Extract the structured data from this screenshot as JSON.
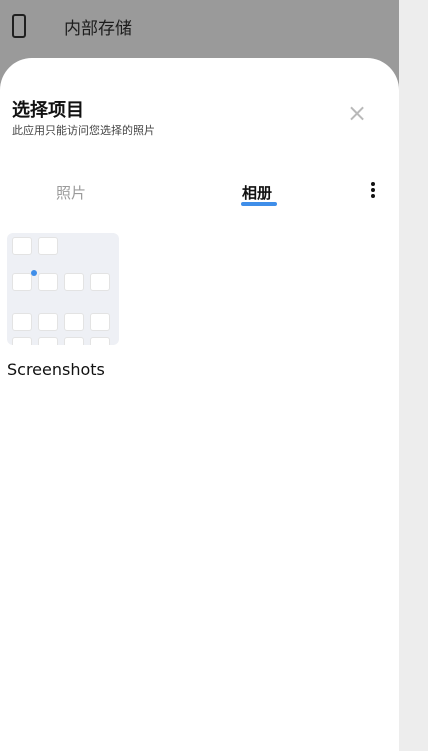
{
  "topbar": {
    "storage_title": "内部存储",
    "device_icon": "phone-icon"
  },
  "sheet": {
    "title": "选择项目",
    "subtitle": "此应用只能访问您选择的照片",
    "close_icon": "close-icon"
  },
  "tabs": [
    {
      "label": "照片",
      "active": false
    },
    {
      "label": "相册",
      "active": true
    }
  ],
  "more_icon": "more-vertical-icon",
  "albums": [
    {
      "name": "Screenshots"
    }
  ],
  "colors": {
    "accent": "#3f8ee9",
    "scrim": "#9a9a9a"
  }
}
